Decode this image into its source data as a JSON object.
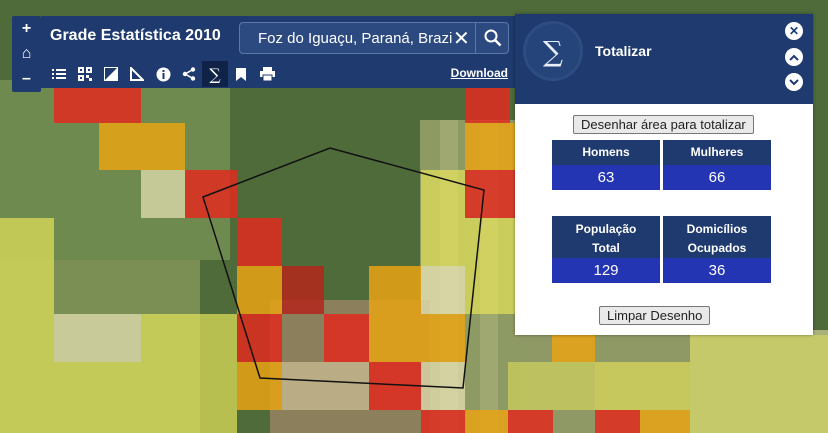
{
  "app": {
    "title": "Grade Estatística 2010"
  },
  "zoom": {
    "in_label": "+",
    "home_label": "⌂",
    "out_label": "–"
  },
  "search": {
    "value": "Foz do Iguaçu, Paraná, Brazil (Cidade)"
  },
  "toolbar": {
    "tools": [
      "list-icon",
      "qr-icon",
      "basemap-icon",
      "measure-icon",
      "info-icon",
      "share-icon",
      "sigma-icon",
      "bookmark-icon",
      "print-icon"
    ],
    "download_label": "Download"
  },
  "panel": {
    "title": "Totalizar",
    "draw_button": "Desenhar área para totalizar",
    "clear_button": "Limpar Desenho",
    "stats": {
      "homens": {
        "label": "Homens",
        "value": "63"
      },
      "mulheres": {
        "label": "Mulheres",
        "value": "66"
      },
      "populacao": {
        "label1": "População",
        "label2": "Total",
        "value": "129"
      },
      "domicilios": {
        "label1": "Domicílios",
        "label2": "Ocupados",
        "value": "36"
      }
    }
  },
  "colors": {
    "header_bg": "#1e3a6e",
    "value_bg": "#2435b3",
    "cell_red": "#e02a1e",
    "cell_orange": "#e8a314",
    "cell_yellow": "#e4e25a"
  }
}
